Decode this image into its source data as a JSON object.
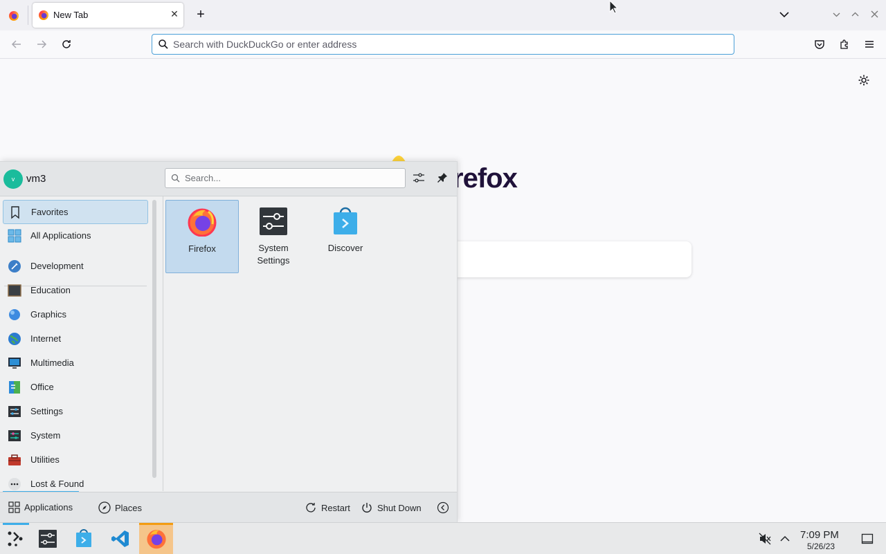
{
  "browser": {
    "tab_title": "New Tab",
    "new_tab_symbol": "+",
    "address_placeholder": "Search with DuckDuckGo or enter address",
    "wordmark": "refox"
  },
  "launcher": {
    "user": {
      "initial": "v",
      "name": "vm3"
    },
    "search_placeholder": "Search...",
    "categories": [
      {
        "label": "Favorites"
      },
      {
        "label": "All Applications"
      },
      {
        "label": "Development"
      },
      {
        "label": "Education"
      },
      {
        "label": "Graphics"
      },
      {
        "label": "Internet"
      },
      {
        "label": "Multimedia"
      },
      {
        "label": "Office"
      },
      {
        "label": "Settings"
      },
      {
        "label": "System"
      },
      {
        "label": "Utilities"
      },
      {
        "label": "Lost & Found"
      }
    ],
    "apps": [
      {
        "label": "Firefox"
      },
      {
        "label": "System\nSettings"
      },
      {
        "label": "Discover"
      }
    ],
    "footer": {
      "applications": "Applications",
      "places": "Places",
      "restart": "Restart",
      "shutdown": "Shut Down"
    }
  },
  "taskbar": {
    "time": "7:09 PM",
    "date": "5/26/23"
  },
  "colors": {
    "accent": "#3daee9",
    "selection_bg": "#d0e2f0",
    "url_focus": "#4a9fd8"
  }
}
